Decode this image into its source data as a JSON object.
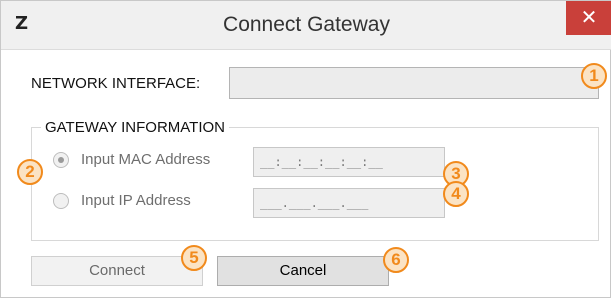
{
  "window": {
    "title": "Connect Gateway",
    "app_icon": "Z",
    "close_label": "✕"
  },
  "network_interface": {
    "label": "NETWORK INTERFACE:",
    "value": ""
  },
  "gateway_information": {
    "title": "GATEWAY INFORMATION",
    "options": [
      {
        "label": "Input MAC Address",
        "selected": true,
        "mask": "__:__:__:__:__:__"
      },
      {
        "label": "Input IP Address",
        "selected": false,
        "mask": "___.___.___.___"
      }
    ]
  },
  "buttons": {
    "connect": "Connect",
    "cancel": "Cancel"
  },
  "callouts": [
    "1",
    "2",
    "3",
    "4",
    "5",
    "6"
  ],
  "colors": {
    "close_button": "#c9403a",
    "callout": "#f18a1c"
  }
}
